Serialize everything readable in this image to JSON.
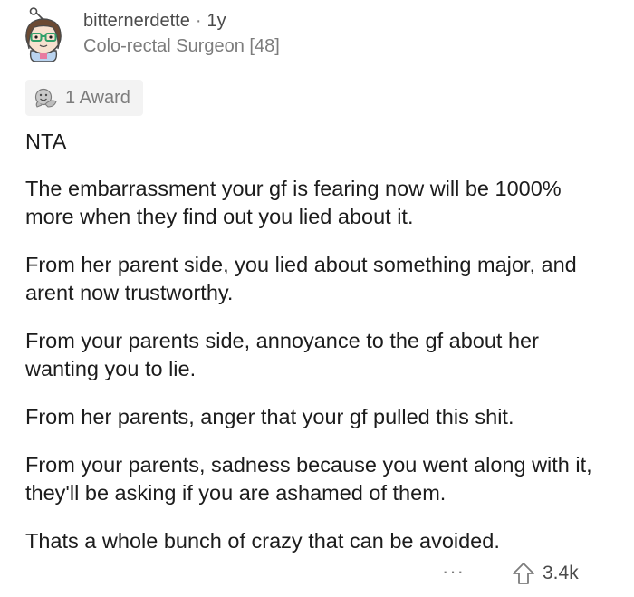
{
  "comment": {
    "username": "bitternerdette",
    "separator": "·",
    "age": "1y",
    "flair": "Colo-rectal Surgeon [48]",
    "award_label": "1 Award",
    "verdict": "NTA",
    "paragraphs": [
      "The embarrassment your gf is fearing now will be 1000% more when they find out you lied about it.",
      "From her parent side, you lied about something major, and arent now trustworthy.",
      "From your parents side, annoyance to the gf about her wanting you to lie.",
      "From her parents, anger that your gf pulled this shit.",
      "From your parents, sadness because you went along with it, they'll be asking if you are ashamed of them.",
      "Thats a whole bunch of crazy that can be avoided."
    ],
    "more_label": "···",
    "upvotes": "3.4k"
  },
  "icons": {
    "avatar": "snoo-avatar-icon",
    "award": "wholesome-award-icon",
    "more": "more-options-icon",
    "upvote": "upvote-arrow-icon"
  }
}
